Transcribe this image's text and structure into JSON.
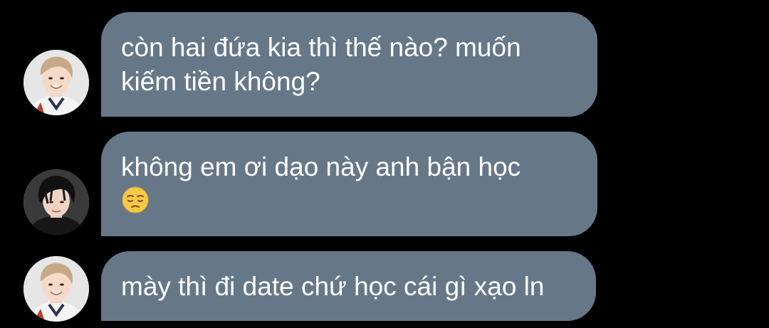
{
  "messages": [
    {
      "sender_avatar": "smiling-boy-avatar",
      "text": "còn hai đứa kia thì thế nào? muốn\nkiếm tiền không?",
      "emoji": ""
    },
    {
      "sender_avatar": "dark-hair-boy-avatar",
      "text": "không em ơi dạo này anh bận học\n",
      "emoji": "pensive-face-emoji"
    },
    {
      "sender_avatar": "smiling-boy-avatar",
      "text": "mày thì đi date chứ học cái gì xạo ln",
      "emoji": ""
    }
  ],
  "colors": {
    "background": "#000000",
    "bubble": "#667888",
    "text": "#ffffff"
  }
}
